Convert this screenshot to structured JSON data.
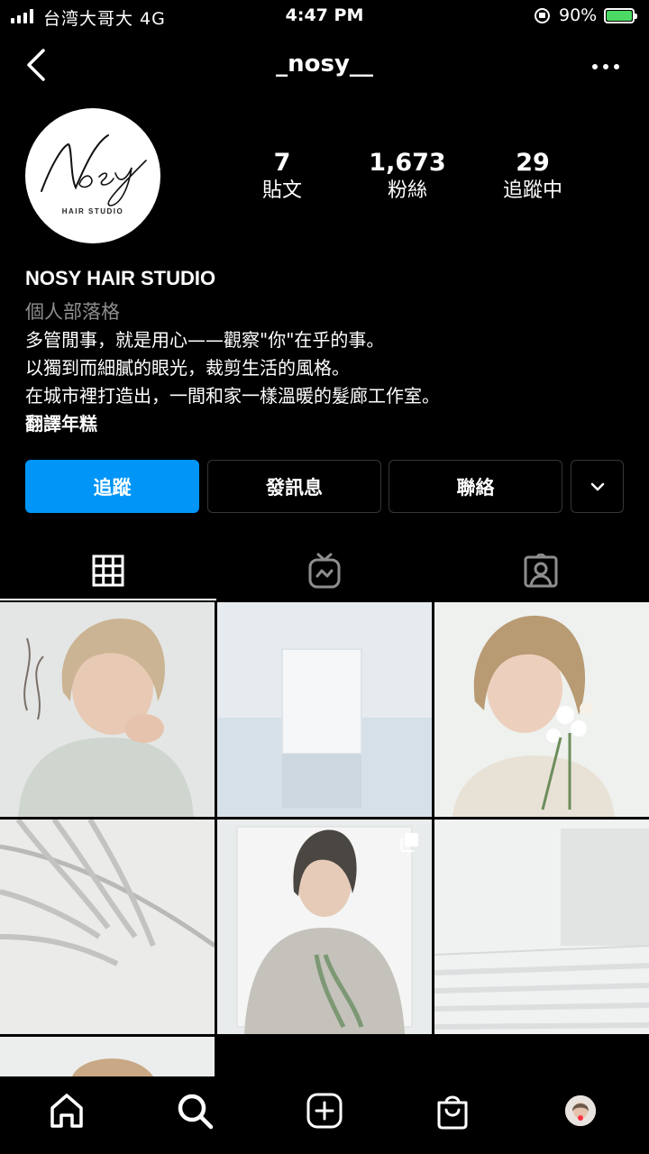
{
  "status_bar": {
    "carrier": "台湾大哥大  4G",
    "time": "4:47 PM",
    "battery": "90%"
  },
  "header": {
    "username": "_nosy__"
  },
  "profile": {
    "logo_script": "Nosy",
    "logo_subtitle": "HAIR STUDIO",
    "stats": [
      {
        "value": "7",
        "label": "貼文"
      },
      {
        "value": "1,673",
        "label": "粉絲"
      },
      {
        "value": "29",
        "label": "追蹤中"
      }
    ],
    "name": "NOSY HAIR STUDIO",
    "category": "個人部落格",
    "bio": [
      "多管閒事，就是用心——觀察\"你\"在乎的事。",
      "以獨到而細膩的眼光，裁剪生活的風格。",
      "在城市裡打造出，一間和家一樣溫暖的髮廊工作室。"
    ],
    "translate_label": "翻譯年糕"
  },
  "actions": {
    "follow": "追蹤",
    "message": "發訊息",
    "contact": "聯絡"
  },
  "tabs": [
    "grid-icon",
    "igtv-icon",
    "tagged-icon"
  ],
  "posts": [
    {
      "desc": "portrait-blonde-bob-hands"
    },
    {
      "desc": "white-block-on-water"
    },
    {
      "desc": "portrait-with-flowers"
    },
    {
      "desc": "palm-shadow"
    },
    {
      "desc": "portrait-knit-sweater",
      "multi": true
    },
    {
      "desc": "white-architecture-stairs"
    },
    {
      "desc": "portrait-partial"
    }
  ],
  "colors": {
    "accent": "#0095f6",
    "background": "#000000",
    "secondary_text": "#8e8e8e",
    "battery": "#4cd964"
  }
}
